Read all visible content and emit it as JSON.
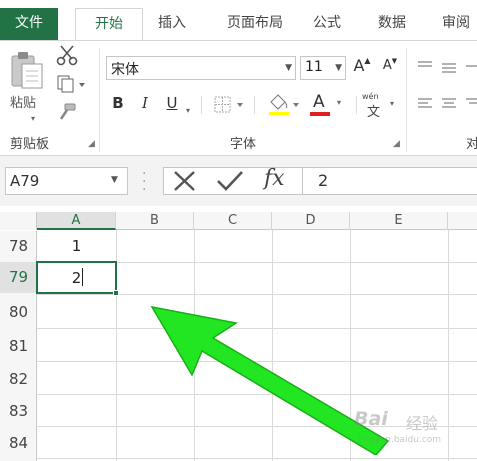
{
  "ribbon": {
    "tabs": [
      "文件",
      "开始",
      "插入",
      "页面布局",
      "公式",
      "数据",
      "审阅"
    ],
    "clipboard": {
      "paste_label": "粘贴",
      "group_label": "剪贴板"
    },
    "font": {
      "font_name": "宋体",
      "font_size": "11",
      "grow_label": "A",
      "shrink_label": "A",
      "bold_label": "B",
      "italic_label": "I",
      "underline_label": "U",
      "font_color_label": "A",
      "phonetic_label": "wén",
      "phonetic_char": "文",
      "group_label": "字体",
      "font_color": "#e02020"
    },
    "next_group_partial": "对"
  },
  "formula_bar": {
    "name_box": "A79",
    "fx_label": "fx",
    "content": "2"
  },
  "grid": {
    "columns": [
      "A",
      "B",
      "C",
      "D",
      "E"
    ],
    "rows": [
      "78",
      "79",
      "80",
      "81",
      "82",
      "83",
      "84"
    ],
    "cells": {
      "A78": "1",
      "A79": "2"
    },
    "active_cell": "A79"
  },
  "watermark": {
    "brand": "Bai",
    "brand_cn": "经验",
    "url": "jingyan.baidu.com"
  },
  "colors": {
    "excel_green": "#217346",
    "annotation_arrow": "#22e622"
  }
}
